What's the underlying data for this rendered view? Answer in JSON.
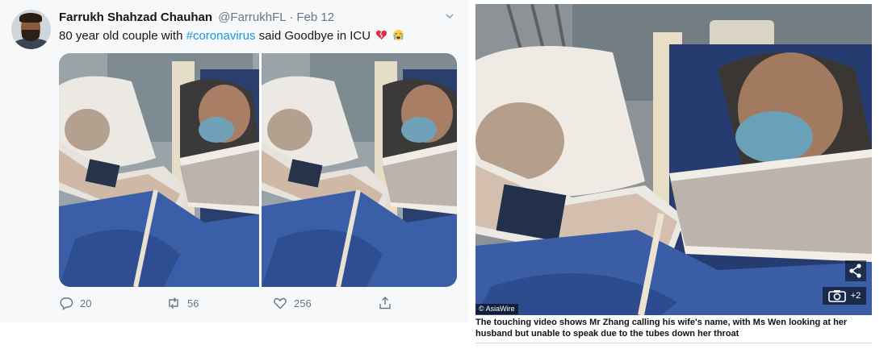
{
  "tweet": {
    "author_name": "Farrukh Shahzad Chauhan",
    "author_handle": "@FarrukhFL",
    "separator": "·",
    "date": "Feb 12",
    "text_before": "80 year old couple with ",
    "hashtag": "#coronavirus",
    "text_after": " said Goodbye in ICU",
    "emojis": [
      "broken-heart-icon",
      "crying-face-icon"
    ],
    "media": {
      "photo_count": 2,
      "description_names": [
        "icu-couple-photo-left",
        "icu-couple-photo-right"
      ]
    },
    "actions": {
      "replies": "20",
      "retweets": "56",
      "likes": "256"
    },
    "icons": {
      "reply": "reply-icon",
      "retweet": "retweet-icon",
      "like": "heart-icon",
      "share": "share-icon",
      "menu": "chevron-down-icon"
    },
    "colors": {
      "accent": "#1b95e0",
      "muted": "#657786",
      "text": "#14171a",
      "background": "#f7f8f9"
    }
  },
  "article": {
    "credit": "© AsiaWire",
    "gallery_count": "+2",
    "caption": "The touching video shows Mr Zhang calling his wife's name, with Ms Wen looking at her husband but unable to speak due to the tubes down her throat",
    "icons": {
      "share": "share-nodes-icon",
      "gallery": "camera-icon"
    }
  }
}
